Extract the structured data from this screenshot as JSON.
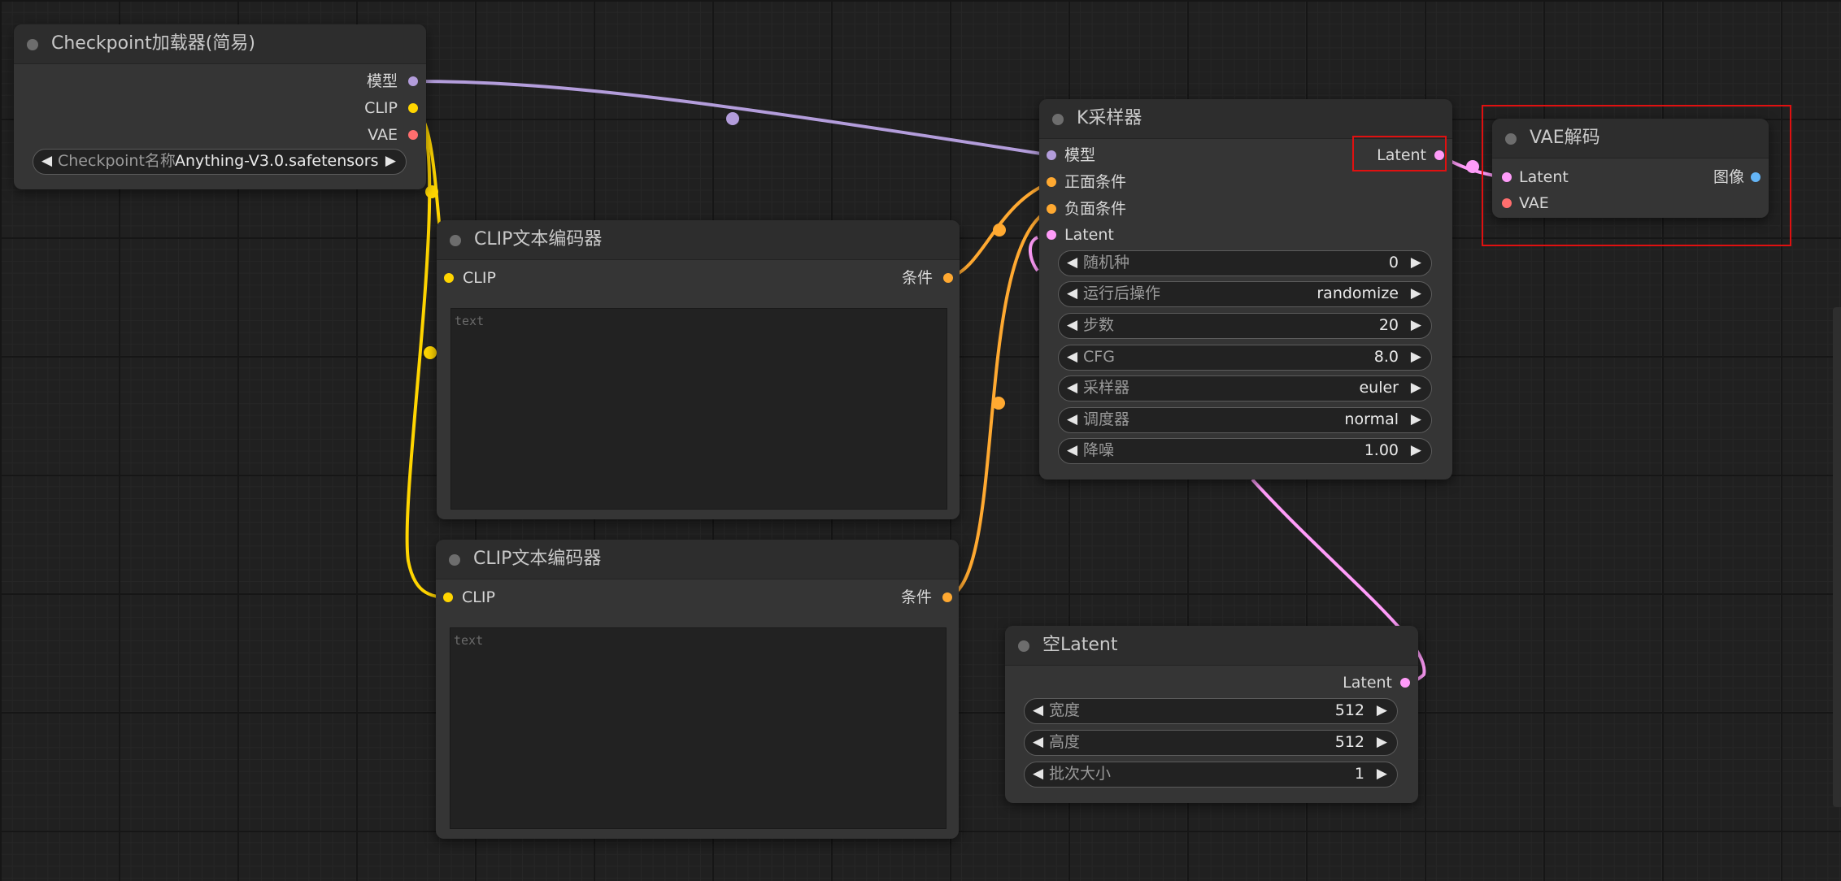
{
  "colors": {
    "model": "#b39ddb",
    "clip": "#ffd500",
    "vae": "#ff6e6e",
    "conditioning": "#ffa931",
    "latent": "#ff9cf9",
    "image": "#64b5f6",
    "highlight": "#e01010"
  },
  "checkpoint_loader": {
    "title": "Checkpoint加载器(简易)",
    "outputs": {
      "model": "模型",
      "clip": "CLIP",
      "vae": "VAE"
    },
    "widget": {
      "label": "Checkpoint名称",
      "value": "Anything-V3.0.safetensors"
    }
  },
  "clip_encoder_positive": {
    "title": "CLIP文本编码器",
    "input": "CLIP",
    "output": "条件",
    "placeholder": "text"
  },
  "clip_encoder_negative": {
    "title": "CLIP文本编码器",
    "input": "CLIP",
    "output": "条件",
    "placeholder": "text"
  },
  "ksampler": {
    "title": "K采样器",
    "inputs": {
      "model": "模型",
      "positive": "正面条件",
      "negative": "负面条件",
      "latent": "Latent"
    },
    "output": "Latent",
    "widgets": [
      {
        "label": "随机种",
        "value": "0"
      },
      {
        "label": "运行后操作",
        "value": "randomize"
      },
      {
        "label": "步数",
        "value": "20"
      },
      {
        "label": "CFG",
        "value": "8.0"
      },
      {
        "label": "采样器",
        "value": "euler"
      },
      {
        "label": "调度器",
        "value": "normal"
      },
      {
        "label": "降噪",
        "value": "1.00"
      }
    ]
  },
  "vae_decode": {
    "title": "VAE解码",
    "inputs": {
      "latent": "Latent",
      "vae": "VAE"
    },
    "output": "图像"
  },
  "empty_latent": {
    "title": "空Latent",
    "output": "Latent",
    "widgets": [
      {
        "label": "宽度",
        "value": "512"
      },
      {
        "label": "高度",
        "value": "512"
      },
      {
        "label": "批次大小",
        "value": "1"
      }
    ]
  }
}
